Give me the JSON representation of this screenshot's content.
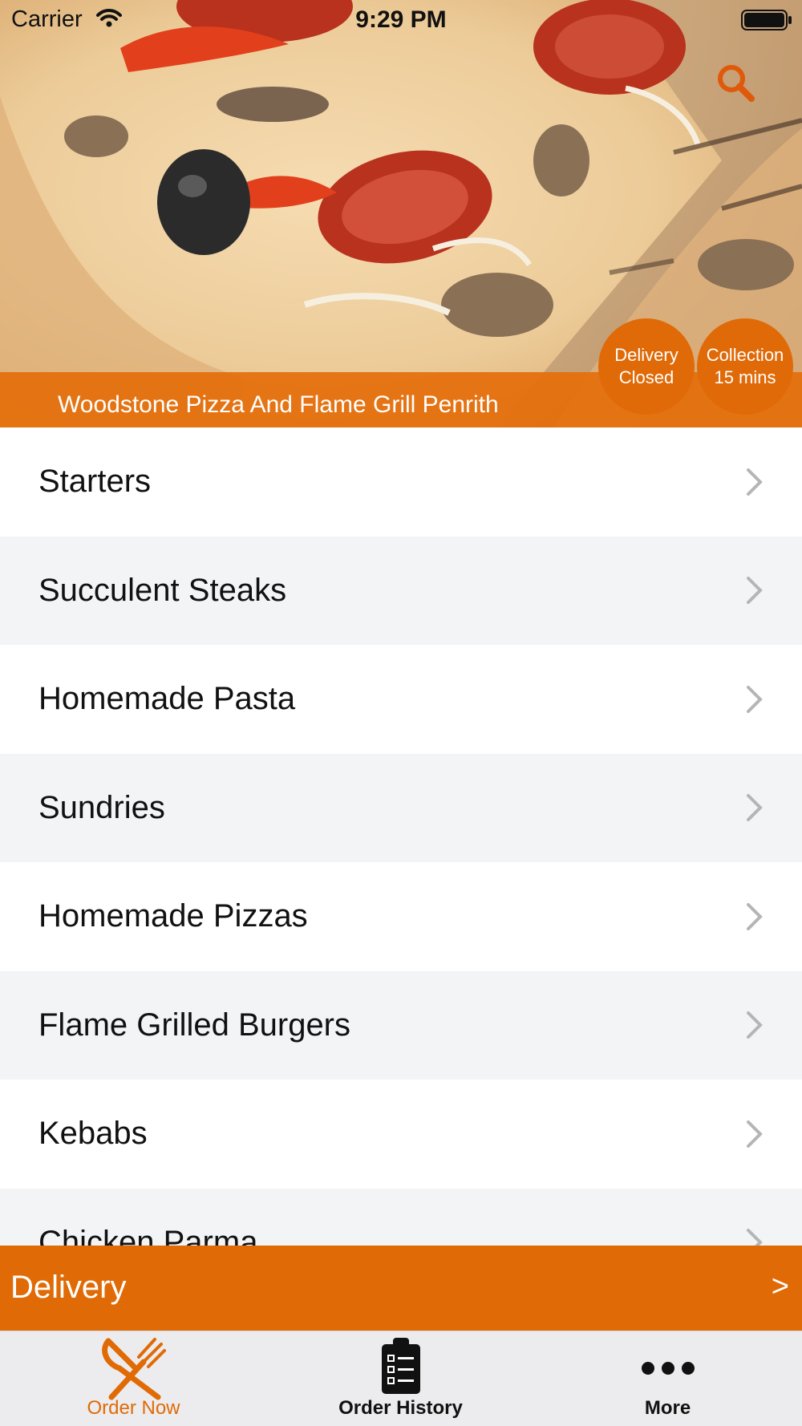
{
  "status_bar": {
    "carrier": "Carrier",
    "time": "9:29 PM",
    "wifi_icon": "wifi-icon",
    "battery_icon": "battery-icon"
  },
  "header": {
    "restaurant_name": "Woodstone Pizza And Flame Grill Penrith",
    "search_icon": "search-icon",
    "badges": {
      "delivery": {
        "line1": "Delivery",
        "line2": "Closed"
      },
      "collection": {
        "line1": "Collection",
        "line2": "15 mins"
      }
    }
  },
  "categories": [
    {
      "label": "Starters"
    },
    {
      "label": "Succulent Steaks"
    },
    {
      "label": "Homemade Pasta"
    },
    {
      "label": "Sundries"
    },
    {
      "label": "Homemade Pizzas"
    },
    {
      "label": "Flame Grilled Burgers"
    },
    {
      "label": "Kebabs"
    },
    {
      "label": "Chicken Parma"
    }
  ],
  "delivery_bar": {
    "label": "Delivery",
    "arrow": ">"
  },
  "tab_bar": {
    "tabs": [
      {
        "label": "Order Now",
        "icon": "fork-knife-icon",
        "active": true
      },
      {
        "label": "Order History",
        "icon": "clipboard-list-icon",
        "active": false
      },
      {
        "label": "More",
        "icon": "more-dots-icon",
        "active": false
      }
    ]
  },
  "colors": {
    "accent": "#e06a06",
    "active_tab": "#e06a06",
    "row_alt": "#f3f4f6"
  }
}
